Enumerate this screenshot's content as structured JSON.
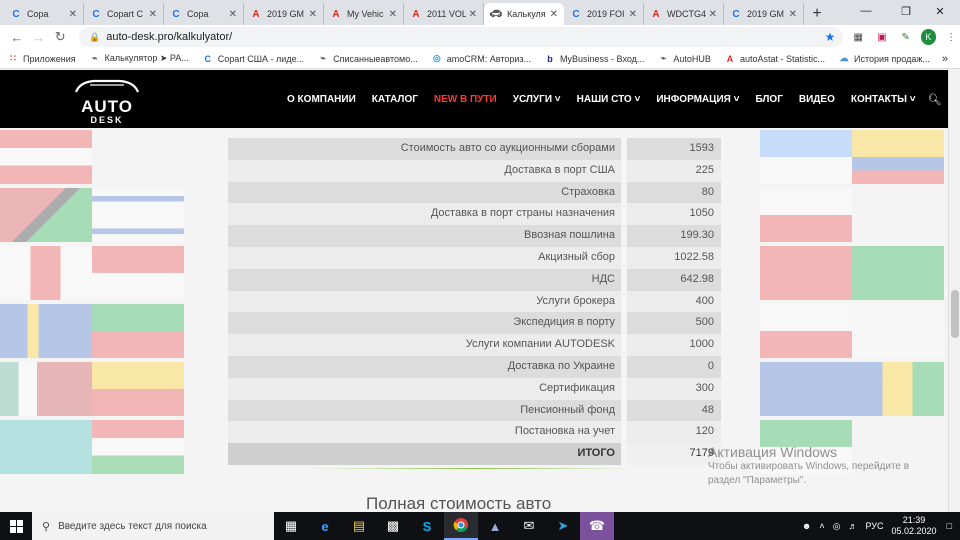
{
  "tabs": [
    {
      "title": "Copa",
      "icon": "C",
      "icon_color": "#1a73e8"
    },
    {
      "title": "Copart C",
      "icon": "C",
      "icon_color": "#1a73e8"
    },
    {
      "title": "Copa",
      "icon": "C",
      "icon_color": "#1a73e8"
    },
    {
      "title": "2019 GM",
      "icon": "A",
      "icon_color": "#d93025"
    },
    {
      "title": "My Vehic",
      "icon": "A",
      "icon_color": "#d93025"
    },
    {
      "title": "2011 VOL",
      "icon": "A",
      "icon_color": "#d93025"
    },
    {
      "title": "Калькуля",
      "icon": "car",
      "icon_color": "#333333",
      "active": true
    },
    {
      "title": "2019 FOI",
      "icon": "C",
      "icon_color": "#1a73e8"
    },
    {
      "title": "WDCTG4",
      "icon": "A",
      "icon_color": "#d93025"
    },
    {
      "title": "2019 GM",
      "icon": "C",
      "icon_color": "#1a73e8"
    }
  ],
  "toolbar": {
    "url": "auto-desk.pro/kalkulyator/",
    "avatar_letter": "K"
  },
  "bookmarks": [
    {
      "label": "Приложения",
      "icon": "apps-icon"
    },
    {
      "label": "Калькулятор ➤ РА...",
      "icon": "car-icon"
    },
    {
      "label": "Copart США - лиде...",
      "icon": "copart-icon"
    },
    {
      "label": "Списанныеавтомо...",
      "icon": "car-icon"
    },
    {
      "label": "amoCRM: Авториз...",
      "icon": "crm-icon"
    },
    {
      "label": "MyBusiness - Вход...",
      "icon": "b-icon"
    },
    {
      "label": "AutoHUB",
      "icon": "car-icon"
    },
    {
      "label": "autoAstat - Statistic...",
      "icon": "a-icon"
    },
    {
      "label": "История продаж...",
      "icon": "cloud-icon"
    }
  ],
  "site": {
    "logo_top": "AUTO",
    "logo_bottom": "DESK",
    "menu": [
      {
        "label": "О КОМПАНИИ",
        "highlight": false,
        "dropdown": false
      },
      {
        "label": "КАТАЛОГ",
        "highlight": false,
        "dropdown": false
      },
      {
        "label": "NEW В ПУТИ",
        "highlight": true,
        "dropdown": false
      },
      {
        "label": "УСЛУГИ",
        "highlight": false,
        "dropdown": true
      },
      {
        "label": "НАШИ СТО",
        "highlight": false,
        "dropdown": true
      },
      {
        "label": "ИНФОРМАЦИЯ",
        "highlight": false,
        "dropdown": true
      },
      {
        "label": "БЛОГ",
        "highlight": false,
        "dropdown": false
      },
      {
        "label": "ВИДЕО",
        "highlight": false,
        "dropdown": false
      },
      {
        "label": "КОНТАКТЫ",
        "highlight": false,
        "dropdown": true
      }
    ]
  },
  "calculator": {
    "rows": [
      {
        "label": "Стоимость авто со аукционными сборами",
        "value": "1593"
      },
      {
        "label": "Доставка в порт США",
        "value": "225"
      },
      {
        "label": "Страховка",
        "value": "80"
      },
      {
        "label": "Доставка в порт страны назначения",
        "value": "1050"
      },
      {
        "label": "Ввозная пошлина",
        "value": "199.30"
      },
      {
        "label": "Акцизный сбор",
        "value": "1022.58"
      },
      {
        "label": "НДС",
        "value": "642.98"
      },
      {
        "label": "Услуги брокера",
        "value": "400"
      },
      {
        "label": "Экспедиция в порту",
        "value": "500"
      },
      {
        "label": "Услуги компании AUTODESK",
        "value": "1000"
      },
      {
        "label": "Доставка по Украине",
        "value": "0"
      },
      {
        "label": "Сертификация",
        "value": "300"
      },
      {
        "label": "Пенсионный фонд",
        "value": "48"
      },
      {
        "label": "Постановка на учет",
        "value": "120"
      }
    ],
    "total": {
      "label": "ИТОГО",
      "value": "7179"
    },
    "section_heading": "Полная стоимость авто"
  },
  "windows_watermark": {
    "line1": "Активация Windows",
    "line2": "Чтобы активировать Windows, перейдите в",
    "line3": "раздел \"Параметры\"."
  },
  "taskbar": {
    "search_placeholder": "Введите здесь текст для поиска",
    "language": "РУС",
    "time": "21:39",
    "date": "05.02.2020"
  }
}
